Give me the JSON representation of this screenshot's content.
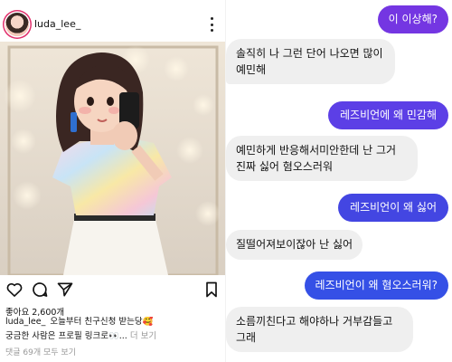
{
  "instagram": {
    "username": "luda_lee_",
    "likes": "좋아요 2,600개",
    "caption_user": "luda_lee_",
    "caption_line1": "오늘부터 친구신청 받는당🥰",
    "caption_line2": "궁금한 사람은 프로필 링크로👀... ",
    "caption_more": "더 보기",
    "comments_link": "댓글 69개 모두 보기",
    "icons": [
      "heart-icon",
      "comment-icon",
      "share-icon",
      "bookmark-icon"
    ]
  },
  "chat": {
    "messages": [
      {
        "sender": "me",
        "text": "이 이상해?"
      },
      {
        "sender": "them",
        "text": "솔직히 나 그런 단어 나오면 많이"
      },
      {
        "sender": "them",
        "text": "예민해"
      },
      {
        "sender": "me",
        "text": "레즈비언에 왜 민감해"
      },
      {
        "sender": "them",
        "text": "예민하게 반응해서미안한데 난 그거"
      },
      {
        "sender": "them",
        "text": "진짜 싫어 혐오스러워"
      },
      {
        "sender": "me",
        "text": "레즈비언이 왜 싫어"
      },
      {
        "sender": "them",
        "text": "질떨어져보이잖아 난 싫어"
      },
      {
        "sender": "me",
        "text": "레즈비언이 왜 혐오스러워?"
      },
      {
        "sender": "them",
        "text": "소름끼친다고 해야하나 거부감들고"
      },
      {
        "sender": "them",
        "text": "그래"
      }
    ]
  },
  "colors": {
    "sent_bubble": "#5a3ee8",
    "received_bubble": "#efefef"
  }
}
